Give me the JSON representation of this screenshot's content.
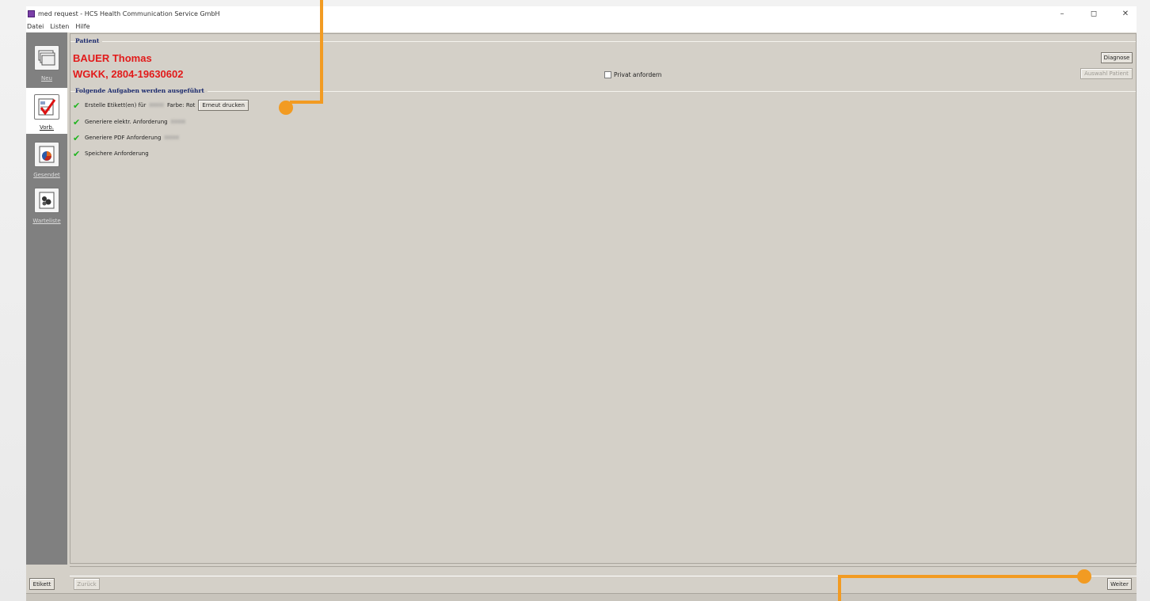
{
  "window": {
    "title": "med request - HCS Health Communication Service GmbH",
    "controls": {
      "minimize": "–",
      "maximize": "◻",
      "close": "✕"
    }
  },
  "menu": [
    "Datei",
    "Listen",
    "Hilfe"
  ],
  "sidebar": {
    "items": [
      {
        "label": "Neu",
        "icon": "stack-icon"
      },
      {
        "label": "Vorb.",
        "icon": "checklist-icon"
      },
      {
        "label": "Gesendet",
        "icon": "document-icon"
      },
      {
        "label": "Warteliste",
        "icon": "waitlist-icon"
      }
    ]
  },
  "patient": {
    "group_title": "Patient",
    "name": "BAUER Thomas",
    "insurance": "WGKK, 2804-19630602",
    "privat_label": "Privat anfordern",
    "diagnose_button": "Diagnose",
    "auswahl_button": "Auswahl Patient"
  },
  "tasks": {
    "group_title": "Folgende Aufgaben werden ausgeführt",
    "items": [
      {
        "prefix": "Erstelle Etikett(en) für",
        "blurred": "ΙΙΙΙΙΙΙΙΙ",
        "suffix": "Farbe: Rot",
        "button": "Erneut drucken"
      },
      {
        "prefix": "Generiere elektr. Anforderung",
        "blurred": "ΙΙΙΙΙΙΙΙΙ",
        "suffix": "",
        "button": ""
      },
      {
        "prefix": "Generiere PDF Anforderung",
        "blurred": "ΙΙΙΙΙΙΙΙΙ",
        "suffix": "",
        "button": ""
      },
      {
        "prefix": "Speichere Anforderung",
        "blurred": "",
        "suffix": "",
        "button": ""
      }
    ],
    "check_glyph": "✔"
  },
  "bottom": {
    "etikett": "Etikett",
    "zurueck": "Zurück",
    "weiter": "Weiter"
  },
  "colors": {
    "accent_callout": "#f29b22",
    "patient_red": "#e21a1a",
    "group_title_blue": "#1c2b6e",
    "check_green": "#1fb51f"
  }
}
